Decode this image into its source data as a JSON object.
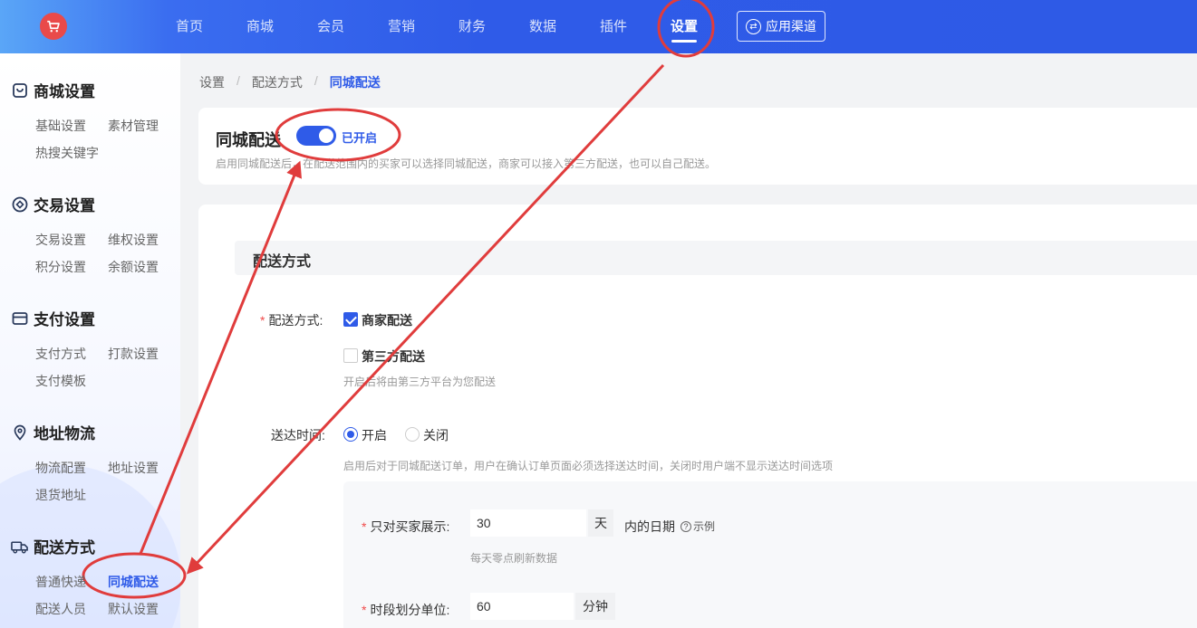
{
  "topbar": {
    "logo_icon": "cart-icon",
    "nav": [
      "首页",
      "商城",
      "会员",
      "营销",
      "财务",
      "数据",
      "插件",
      "设置"
    ],
    "active_nav": "设置",
    "channel_button": "应用渠道",
    "channel_icon": "exchange-icon"
  },
  "sidebar": {
    "groups": [
      {
        "title": "商城设置",
        "icon": "shop-bag-icon",
        "items": [
          "基础设置",
          "素材管理",
          "热搜关键字"
        ]
      },
      {
        "title": "交易设置",
        "icon": "diamond-circle-icon",
        "items": [
          "交易设置",
          "维权设置",
          "积分设置",
          "余额设置"
        ]
      },
      {
        "title": "支付设置",
        "icon": "card-icon",
        "items": [
          "支付方式",
          "打款设置",
          "支付模板"
        ]
      },
      {
        "title": "地址物流",
        "icon": "location-pin-icon",
        "items": [
          "物流配置",
          "地址设置",
          "退货地址"
        ]
      },
      {
        "title": "配送方式",
        "icon": "truck-icon",
        "items": [
          "普通快递",
          "同城配送",
          "配送人员",
          "默认设置"
        ]
      }
    ],
    "active_item": "同城配送"
  },
  "breadcrumb": [
    "设置",
    "配送方式",
    "同城配送"
  ],
  "header_card": {
    "title": "同城配送",
    "toggle_on": true,
    "toggle_label": "已开启",
    "description": "启用同城配送后，在配送范围内的买家可以选择同城配送，商家可以接入第三方配送，也可以自己配送。"
  },
  "form": {
    "section_title": "配送方式",
    "delivery_label": "配送方式:",
    "options": [
      {
        "label": "商家配送",
        "checked": true
      },
      {
        "label": "第三方配送",
        "checked": false
      }
    ],
    "third_party_hint": "开启后将由第三方平台为您配送",
    "time_label": "送达时间:",
    "time_radios": [
      {
        "label": "开启",
        "selected": true
      },
      {
        "label": "关闭",
        "selected": false
      }
    ],
    "time_hint": "启用后对于同城配送订单，用户在确认订单页面必须选择送达时间，关闭时用户端不显示送达时间选项",
    "show_days_label": "只对买家展示:",
    "show_days_value": "30",
    "show_days_unit": "天",
    "show_days_suffix": "内的日期",
    "example_label": "示例",
    "show_days_hint": "每天零点刷新数据",
    "slot_label": "时段划分单位:",
    "slot_value": "60",
    "slot_unit": "分钟"
  },
  "annotation_color": "#e03c3c"
}
